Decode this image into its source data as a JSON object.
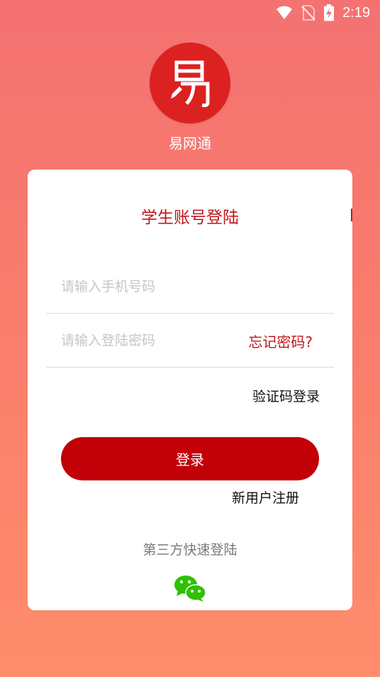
{
  "status_bar": {
    "time": "2:19",
    "icons": [
      "wifi-icon",
      "no-sim-icon",
      "battery-charging-icon"
    ]
  },
  "app": {
    "logo_icon": "pen-logo-icon",
    "name": "易网通"
  },
  "login_card": {
    "title": "学生账号登陆",
    "phone_placeholder": "请输入手机号码",
    "password_placeholder": "请输入登陆密码",
    "forgot_password": "忘记密码?",
    "sms_login": "验证码登录",
    "login_button": "登录",
    "register_link": "新用户注册",
    "third_party_label": "第三方快速登陆",
    "third_party_icon": "wechat-icon"
  },
  "colors": {
    "accent": "#c0161b",
    "button": "#c10007",
    "background_top": "#f47272",
    "background_bottom": "#ff8c6c",
    "wechat_green": "#2dc100"
  }
}
